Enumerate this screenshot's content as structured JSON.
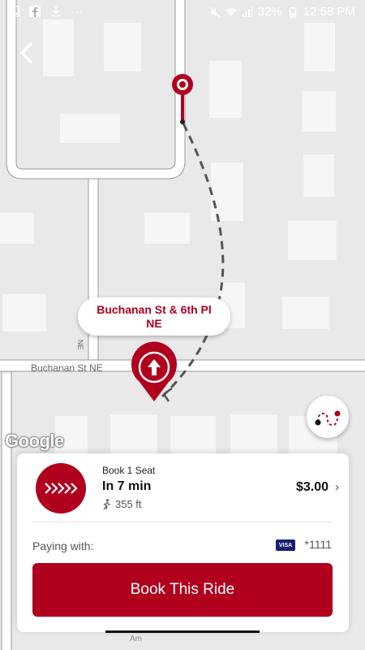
{
  "status_bar": {
    "battery": "32%",
    "time": "12:58 PM",
    "more": "···"
  },
  "map": {
    "street_label": "Buchanan St NE",
    "vertical_street_label": "NE",
    "bottom_street_fragment": "Am",
    "attribution": "Google"
  },
  "pickup_callout": {
    "text": "Buchanan St & 6th Pl NE"
  },
  "ride": {
    "seat_label": "Book 1 Seat",
    "eta": "In 7 min",
    "walk_distance": "355 ft",
    "price": "$3.00",
    "price_chevron": "›"
  },
  "payment": {
    "label": "Paying with:",
    "card_brand": "VISA",
    "card_number": "*1111"
  },
  "book_button": {
    "label": "Book This Ride"
  },
  "colors": {
    "accent": "#b0001e"
  }
}
